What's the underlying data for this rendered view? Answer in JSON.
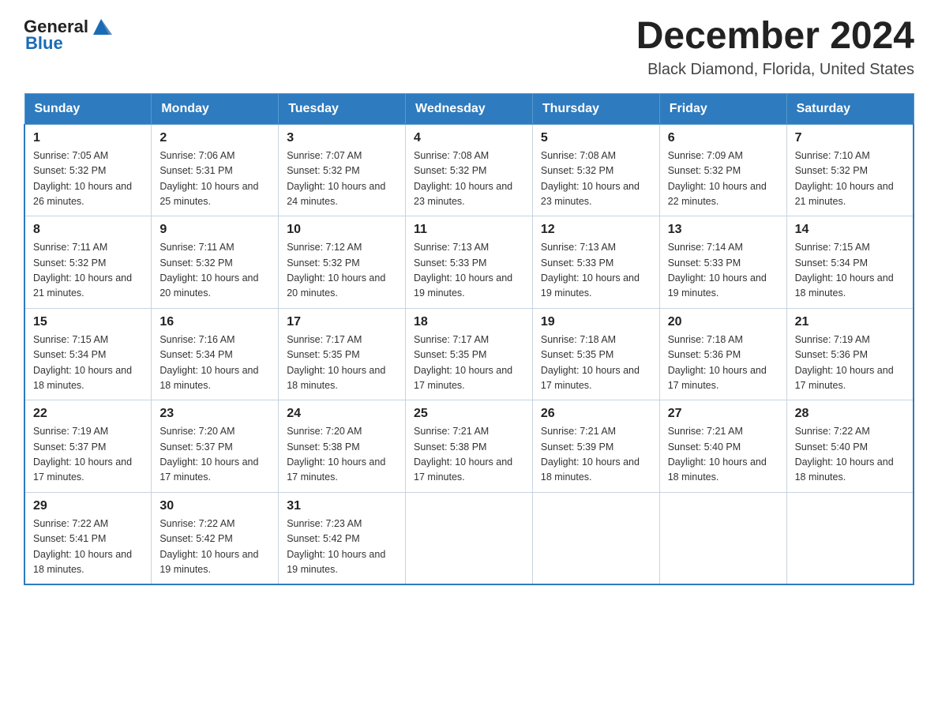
{
  "header": {
    "logo_general": "General",
    "logo_blue": "Blue",
    "title": "December 2024",
    "subtitle": "Black Diamond, Florida, United States"
  },
  "calendar": {
    "days_of_week": [
      "Sunday",
      "Monday",
      "Tuesday",
      "Wednesday",
      "Thursday",
      "Friday",
      "Saturday"
    ],
    "weeks": [
      [
        {
          "day": "1",
          "sunrise": "7:05 AM",
          "sunset": "5:32 PM",
          "daylight": "10 hours and 26 minutes."
        },
        {
          "day": "2",
          "sunrise": "7:06 AM",
          "sunset": "5:31 PM",
          "daylight": "10 hours and 25 minutes."
        },
        {
          "day": "3",
          "sunrise": "7:07 AM",
          "sunset": "5:32 PM",
          "daylight": "10 hours and 24 minutes."
        },
        {
          "day": "4",
          "sunrise": "7:08 AM",
          "sunset": "5:32 PM",
          "daylight": "10 hours and 23 minutes."
        },
        {
          "day": "5",
          "sunrise": "7:08 AM",
          "sunset": "5:32 PM",
          "daylight": "10 hours and 23 minutes."
        },
        {
          "day": "6",
          "sunrise": "7:09 AM",
          "sunset": "5:32 PM",
          "daylight": "10 hours and 22 minutes."
        },
        {
          "day": "7",
          "sunrise": "7:10 AM",
          "sunset": "5:32 PM",
          "daylight": "10 hours and 21 minutes."
        }
      ],
      [
        {
          "day": "8",
          "sunrise": "7:11 AM",
          "sunset": "5:32 PM",
          "daylight": "10 hours and 21 minutes."
        },
        {
          "day": "9",
          "sunrise": "7:11 AM",
          "sunset": "5:32 PM",
          "daylight": "10 hours and 20 minutes."
        },
        {
          "day": "10",
          "sunrise": "7:12 AM",
          "sunset": "5:32 PM",
          "daylight": "10 hours and 20 minutes."
        },
        {
          "day": "11",
          "sunrise": "7:13 AM",
          "sunset": "5:33 PM",
          "daylight": "10 hours and 19 minutes."
        },
        {
          "day": "12",
          "sunrise": "7:13 AM",
          "sunset": "5:33 PM",
          "daylight": "10 hours and 19 minutes."
        },
        {
          "day": "13",
          "sunrise": "7:14 AM",
          "sunset": "5:33 PM",
          "daylight": "10 hours and 19 minutes."
        },
        {
          "day": "14",
          "sunrise": "7:15 AM",
          "sunset": "5:34 PM",
          "daylight": "10 hours and 18 minutes."
        }
      ],
      [
        {
          "day": "15",
          "sunrise": "7:15 AM",
          "sunset": "5:34 PM",
          "daylight": "10 hours and 18 minutes."
        },
        {
          "day": "16",
          "sunrise": "7:16 AM",
          "sunset": "5:34 PM",
          "daylight": "10 hours and 18 minutes."
        },
        {
          "day": "17",
          "sunrise": "7:17 AM",
          "sunset": "5:35 PM",
          "daylight": "10 hours and 18 minutes."
        },
        {
          "day": "18",
          "sunrise": "7:17 AM",
          "sunset": "5:35 PM",
          "daylight": "10 hours and 17 minutes."
        },
        {
          "day": "19",
          "sunrise": "7:18 AM",
          "sunset": "5:35 PM",
          "daylight": "10 hours and 17 minutes."
        },
        {
          "day": "20",
          "sunrise": "7:18 AM",
          "sunset": "5:36 PM",
          "daylight": "10 hours and 17 minutes."
        },
        {
          "day": "21",
          "sunrise": "7:19 AM",
          "sunset": "5:36 PM",
          "daylight": "10 hours and 17 minutes."
        }
      ],
      [
        {
          "day": "22",
          "sunrise": "7:19 AM",
          "sunset": "5:37 PM",
          "daylight": "10 hours and 17 minutes."
        },
        {
          "day": "23",
          "sunrise": "7:20 AM",
          "sunset": "5:37 PM",
          "daylight": "10 hours and 17 minutes."
        },
        {
          "day": "24",
          "sunrise": "7:20 AM",
          "sunset": "5:38 PM",
          "daylight": "10 hours and 17 minutes."
        },
        {
          "day": "25",
          "sunrise": "7:21 AM",
          "sunset": "5:38 PM",
          "daylight": "10 hours and 17 minutes."
        },
        {
          "day": "26",
          "sunrise": "7:21 AM",
          "sunset": "5:39 PM",
          "daylight": "10 hours and 18 minutes."
        },
        {
          "day": "27",
          "sunrise": "7:21 AM",
          "sunset": "5:40 PM",
          "daylight": "10 hours and 18 minutes."
        },
        {
          "day": "28",
          "sunrise": "7:22 AM",
          "sunset": "5:40 PM",
          "daylight": "10 hours and 18 minutes."
        }
      ],
      [
        {
          "day": "29",
          "sunrise": "7:22 AM",
          "sunset": "5:41 PM",
          "daylight": "10 hours and 18 minutes."
        },
        {
          "day": "30",
          "sunrise": "7:22 AM",
          "sunset": "5:42 PM",
          "daylight": "10 hours and 19 minutes."
        },
        {
          "day": "31",
          "sunrise": "7:23 AM",
          "sunset": "5:42 PM",
          "daylight": "10 hours and 19 minutes."
        },
        null,
        null,
        null,
        null
      ]
    ],
    "sunrise_label": "Sunrise:",
    "sunset_label": "Sunset:",
    "daylight_label": "Daylight:"
  }
}
